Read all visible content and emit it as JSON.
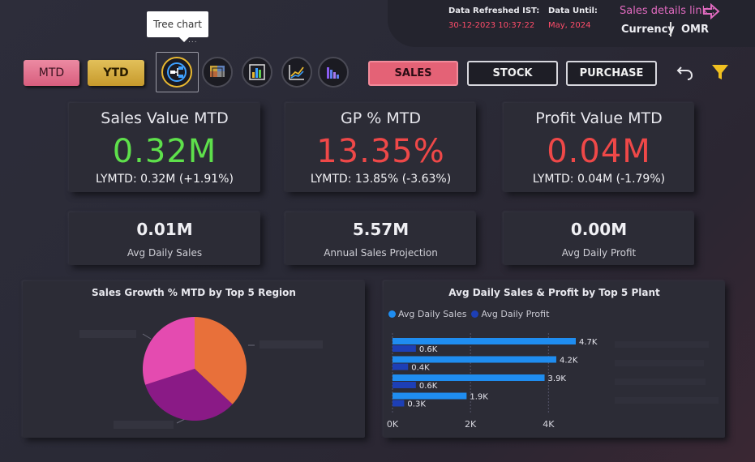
{
  "header": {
    "refreshed_label": "Data Refreshed IST:",
    "refreshed_value": "30-12-2023 10:37:22",
    "until_label": "Data Until:",
    "until_value": "May, 2024",
    "sales_link": "Sales details link :",
    "currency_label": "Currency",
    "currency_value": "OMR"
  },
  "tooltip": {
    "text": "Tree chart",
    "dots": "..."
  },
  "period_buttons": {
    "mtd": "MTD",
    "ytd": "YTD"
  },
  "icons": {
    "tree": "tree-chart-icon",
    "matrix": "matrix-icon",
    "column": "column-chart-icon",
    "line": "line-chart-icon",
    "bar": "bar-chart-icon",
    "undo": "undo-icon",
    "filter": "filter-icon",
    "arrow": "arrow-right-icon"
  },
  "nav": {
    "sales": "SALES",
    "stock": "STOCK",
    "purchase": "PURCHASE"
  },
  "kpis": [
    {
      "title": "Sales Value MTD",
      "value": "0.32M",
      "sub": "LYMTD: 0.32M (+1.91%)",
      "color": "#5ee04b"
    },
    {
      "title": "GP % MTD",
      "value": "13.35%",
      "sub": "LYMTD: 13.85% (-3.63%)",
      "color": "#ef4848"
    },
    {
      "title": "Profit Value MTD",
      "value": "0.04M",
      "sub": "LYMTD: 0.04M (-1.79%)",
      "color": "#ef4848"
    }
  ],
  "small_kpis": [
    {
      "value": "0.01M",
      "label": "Avg Daily Sales"
    },
    {
      "value": "5.57M",
      "label": "Annual Sales Projection"
    },
    {
      "value": "0.00M",
      "label": "Avg Daily Profit"
    }
  ],
  "pie_chart": {
    "title": "Sales Growth % MTD by Top 5 Region",
    "chart_data": {
      "type": "pie",
      "title": "Sales Growth % MTD by Top 5 Region",
      "slices": [
        {
          "value": 37,
          "color": "#e8703a"
        },
        {
          "value": 33,
          "color": "#8a1a86"
        },
        {
          "value": 30,
          "color": "#e44bb0"
        }
      ]
    }
  },
  "bar_chart": {
    "title": "Avg Daily Sales & Profit by Top 5 Plant",
    "legend": [
      "Avg Daily Sales",
      "Avg Daily Profit"
    ],
    "chart_data": {
      "type": "bar",
      "title": "Avg Daily Sales & Profit by Top 5 Plant",
      "orientation": "horizontal",
      "series": [
        {
          "name": "Avg Daily Sales",
          "values": [
            4.7,
            4.2,
            3.9,
            1.9
          ],
          "labels": [
            "4.7K",
            "4.2K",
            "3.9K",
            "1.9K"
          ],
          "color": "#1f8df0"
        },
        {
          "name": "Avg Daily Profit",
          "values": [
            0.6,
            0.4,
            0.6,
            0.3
          ],
          "labels": [
            "0.6K",
            "0.4K",
            "0.6K",
            "0.3K"
          ],
          "color": "#1d3fb6"
        }
      ],
      "xticks": [
        "0K",
        "2K",
        "4K"
      ],
      "xlim": [
        0,
        4.7
      ]
    }
  }
}
